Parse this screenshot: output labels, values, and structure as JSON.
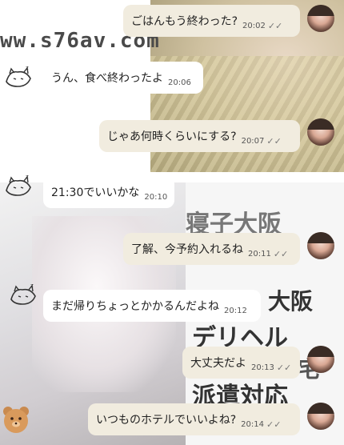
{
  "watermark": "ww.s76av.com",
  "ad_text": [
    "寝子大阪",
    "大阪",
    "デリヘル",
    "宅",
    "派遣対応"
  ],
  "messages": [
    {
      "side": "right",
      "text": "ごはんもう終わった?",
      "time": "20:02",
      "read": true
    },
    {
      "side": "left",
      "text": "うん、食べ終わったよ",
      "time": "20:06",
      "read": false
    },
    {
      "side": "right",
      "text": "じゃあ何時くらいにする?",
      "time": "20:07",
      "read": true
    },
    {
      "side": "left",
      "text": "21:30でいいかな",
      "time": "20:10",
      "read": false
    },
    {
      "side": "right",
      "text": "了解、今予約入れるね",
      "time": "20:11",
      "read": true
    },
    {
      "side": "left",
      "text": "まだ帰りちょっとかかるんだよね",
      "time": "20:12",
      "read": false
    },
    {
      "side": "right",
      "text": "大丈夫だよ",
      "time": "20:13",
      "read": true
    },
    {
      "side": "right",
      "text": "いつものホテルでいいよね?",
      "time": "20:14",
      "read": true
    }
  ],
  "read_check_glyph": "✓✓",
  "colors": {
    "right_bubble": "#f1ecdf",
    "left_bubble": "#ffffff"
  },
  "icons": {
    "left_avatar": "sleepy-cat-doodle-icon",
    "right_avatar": "woman-avatar-photo",
    "corner": "teddy-bear-icon"
  }
}
